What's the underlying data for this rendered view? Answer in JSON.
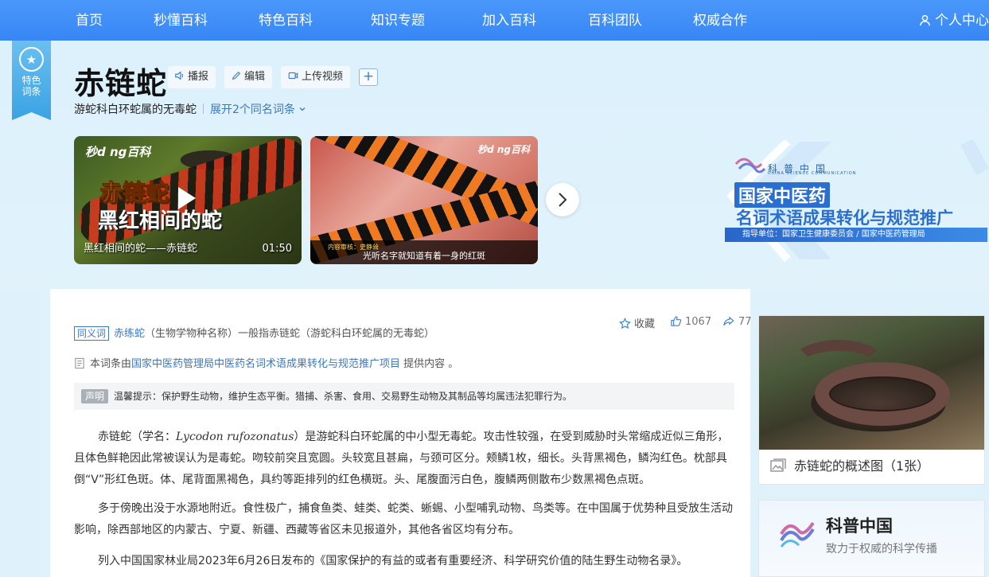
{
  "nav": {
    "items": [
      "首页",
      "秒懂百科",
      "特色百科",
      "知识专题",
      "加入百科",
      "百科团队",
      "权威合作"
    ],
    "user": "个人中心"
  },
  "ribbon": {
    "line1": "特色",
    "line2": "词条"
  },
  "entry": {
    "title": "赤链蛇",
    "tools": {
      "broadcast": "播报",
      "edit": "编辑",
      "upload": "上传视频"
    },
    "subtitle": "游蛇科白环蛇属的无毒蛇",
    "expand": "展开2个同名词条"
  },
  "videos": [
    {
      "brand": "秒d ng百科",
      "big1": "赤链蛇",
      "big2": "黑红相间的蛇",
      "caption": "黑红相间的蛇——赤链蛇",
      "duration": "01:50"
    },
    {
      "brand": "秒d ng百科",
      "reviewer": "内容审核：史静耸",
      "caption": "光听名字就知道有着一身的红斑"
    }
  ],
  "banner": {
    "org": "科普中国",
    "org_en": "CHINA SCIENCE COMMUNICATION",
    "line1": "国家中医药",
    "line2": "名词术语成果转化与规范推广",
    "guide": "指导单位：国家卫生健康委员会 / 国家中医药管理局"
  },
  "actions": {
    "collect": "收藏",
    "likes": "1067",
    "shares": "77"
  },
  "synonym": {
    "tag": "同义词",
    "word": "赤练蛇",
    "note": "（生物学物种名称）一般指赤链蛇（游蛇科白环蛇属的无毒蛇）"
  },
  "provide": {
    "prefix": "本词条由",
    "link": "国家中医药管理局中医药名词术语成果转化与规范推广项目",
    "suffix": " 提供内容 。"
  },
  "notice": {
    "tag": "声明",
    "text": "温馨提示：保护野生动物，维护生态平衡。猎捕、杀害、食用、交易野生动物及其制品等均属违法犯罪行为。"
  },
  "paragraphs": {
    "p1_a": "赤链蛇（学名：",
    "p1_sci": "Lycodon rufozonatus",
    "p1_b": "）是游蛇科白环蛇属的中小型无毒蛇。攻击性较强，在受到威胁时头常缩成近似三角形，且体色鲜艳因此常被误认为是毒蛇。吻较前突且宽圆。头较宽且甚扁，与颈可区分。颊鳞1枚，细长。头背黑褐色，鳞沟红色。枕部具倒“V”形红色斑。体、尾背面黑褐色，具约等距排列的红色横斑。头、尾腹面污白色，腹鳞两侧散布少数黑褐色点斑。",
    "p2": "多于傍晚出没于水源地附近。食性极广，捕食鱼类、蛙类、蛇类、蜥蜴、小型哺乳动物、鸟类等。在中国属于优势种且受放生活动影响，除西部地区的内蒙古、宁夏、新疆、西藏等省区未见报道外，其他各省区均有分布。",
    "p3": "列入中国国家林业局2023年6月26日发布的《国家保护的有益的或者有重要经济、科学研究价值的陆生野生动物名录》。"
  },
  "sidebar": {
    "photo_caption": "赤链蛇的概述图（1张）",
    "kp_name": "科普中国",
    "kp_desc": "致力于权威的科学传播"
  }
}
